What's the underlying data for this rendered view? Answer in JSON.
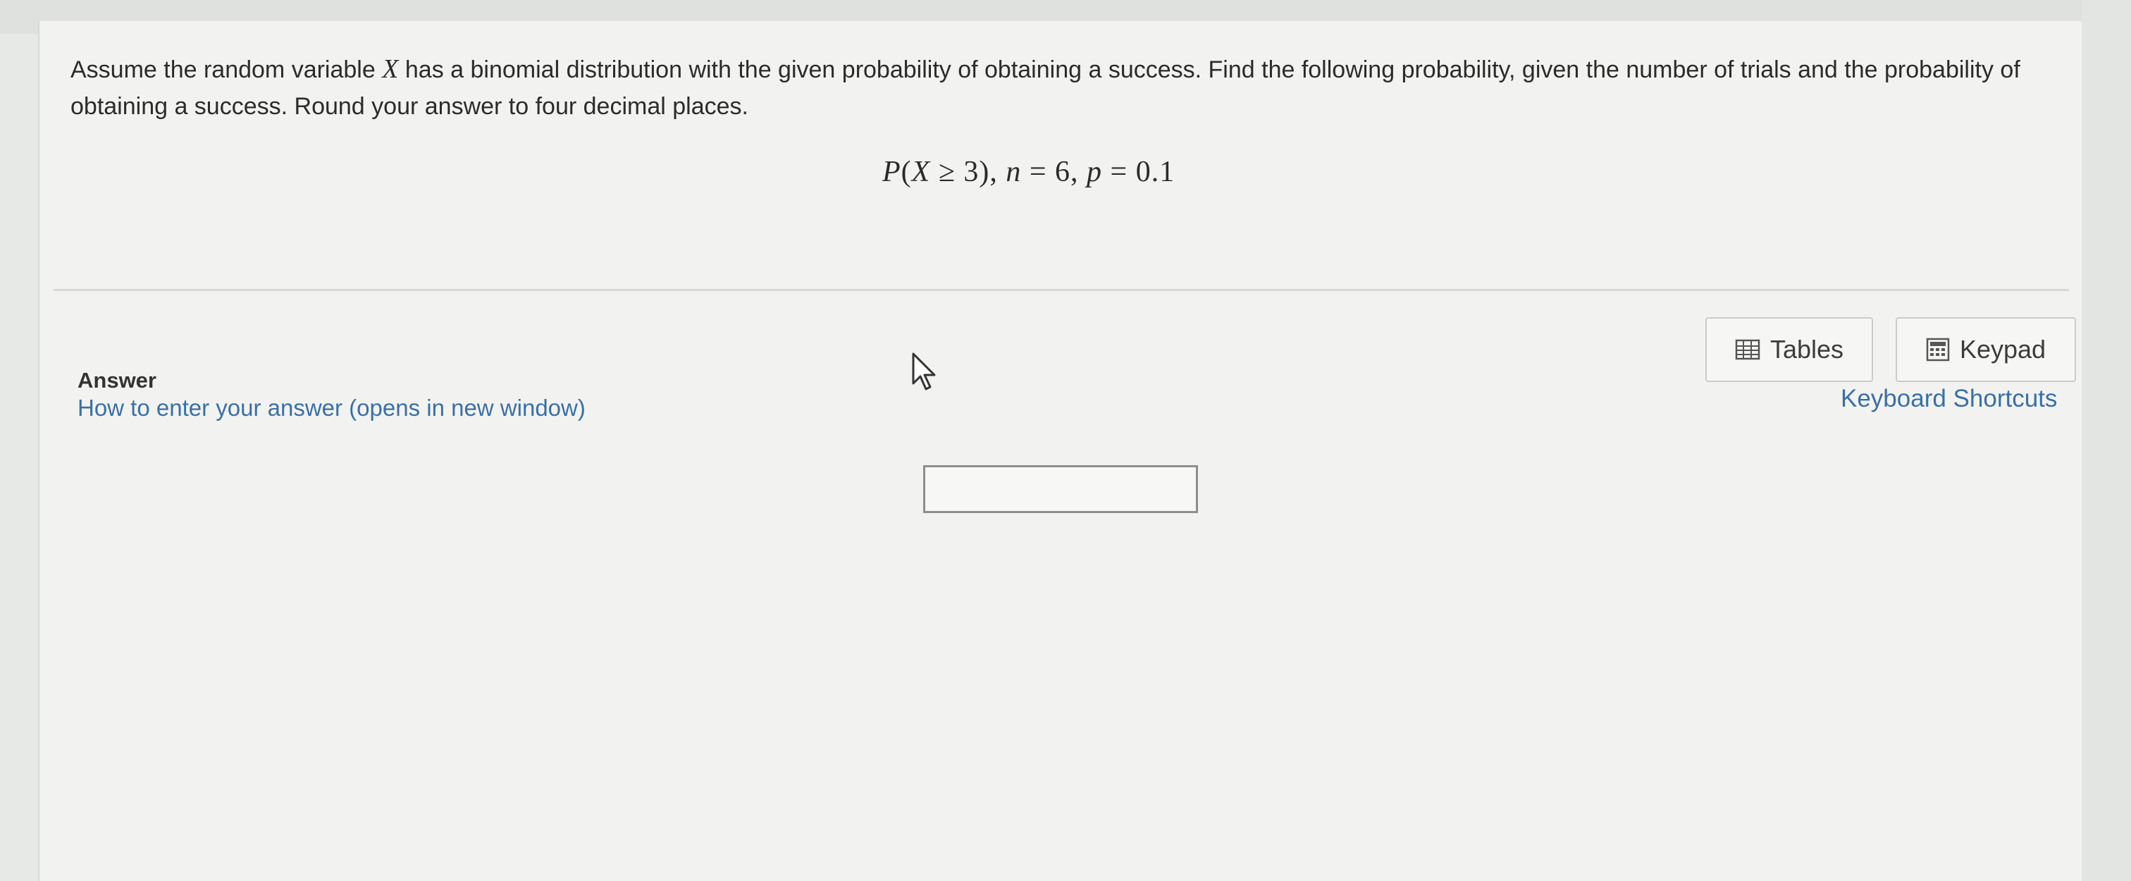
{
  "question": {
    "text_part1": "Assume the random variable ",
    "variable": "X",
    "text_part2": " has a binomial distribution with the given probability of obtaining a success. Find the following probability, given the number of trials and the probability of obtaining a success. Round your answer to four decimal places.",
    "math": {
      "p": "P",
      "open": "(",
      "x": "X",
      "rel": " ≥ 3), ",
      "n": "n",
      "n_val": " = 6, ",
      "pv": "p",
      "p_val": " = 0.1"
    }
  },
  "answer": {
    "label": "Answer",
    "help_link": "How to enter your answer (opens in new window)",
    "input_value": "",
    "input_placeholder": ""
  },
  "toolbar": {
    "tables_label": "Tables",
    "keypad_label": "Keypad",
    "shortcuts_label": "Keyboard Shortcuts"
  },
  "icons": {
    "tables": "table-grid-icon",
    "keypad": "calculator-icon",
    "cursor": "mouse-pointer-icon"
  },
  "colors": {
    "link": "#3a6fa8",
    "background": "#f2f3f1"
  }
}
